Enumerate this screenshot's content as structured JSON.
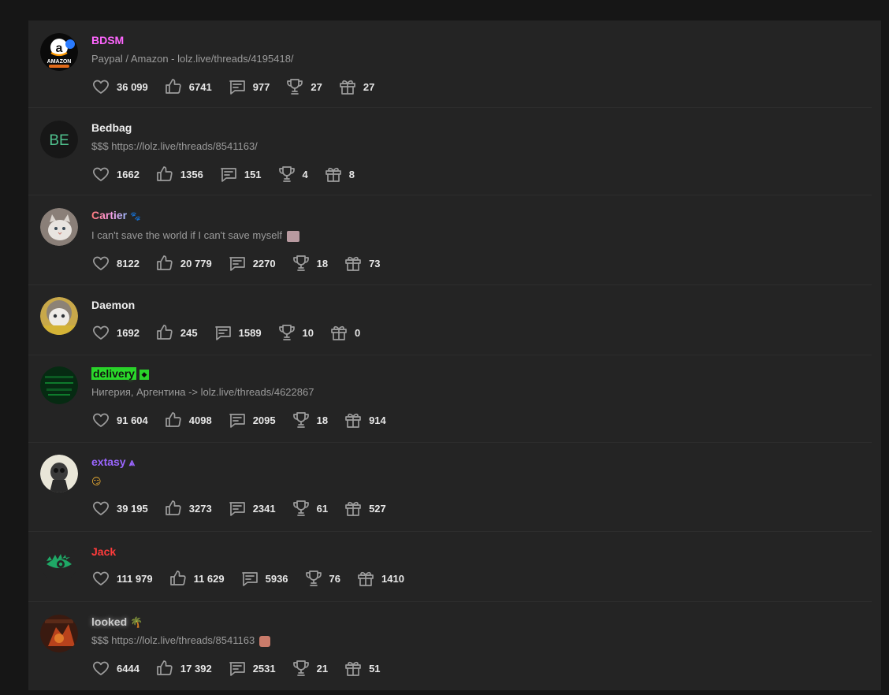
{
  "users": [
    {
      "name": "BDSM",
      "name_color": "#ff66ff",
      "status": "Paypal / Amazon - lolz.live/threads/4195418/",
      "avatar": "amazon-logo",
      "stats": {
        "likes": "36 099",
        "thumbs": "6741",
        "messages": "977",
        "trophies": "27",
        "gifts": "27"
      }
    },
    {
      "name": "Bedbag",
      "name_color": "#eeeeee",
      "status": "$$$ https://lolz.live/threads/8541163/",
      "avatar": "initials-BE",
      "avatar_text": "BE",
      "stats": {
        "likes": "1662",
        "thumbs": "1356",
        "messages": "151",
        "trophies": "4",
        "gifts": "8"
      }
    },
    {
      "name": "Cartier",
      "name_color": "#ff8ad8",
      "status": "I can't save the world if I can't save myself",
      "avatar": "cat-photo",
      "stats": {
        "likes": "8122",
        "thumbs": "20 779",
        "messages": "2270",
        "trophies": "18",
        "gifts": "73"
      }
    },
    {
      "name": "Daemon",
      "name_color": "#eeeeee",
      "status": "",
      "avatar": "kitten-photo",
      "stats": {
        "likes": "1692",
        "thumbs": "245",
        "messages": "1589",
        "trophies": "10",
        "gifts": "0"
      }
    },
    {
      "name": "delivery",
      "name_color": "#33ff33",
      "status": "Нигерия, Аргентина -> lolz.live/threads/4622867",
      "avatar": "green-matrix",
      "stats": {
        "likes": "91 604",
        "thumbs": "4098",
        "messages": "2095",
        "trophies": "18",
        "gifts": "914"
      }
    },
    {
      "name": "extasy",
      "name_color": "#9a66ff",
      "status": "",
      "avatar": "skull-art",
      "stats": {
        "likes": "39 195",
        "thumbs": "3273",
        "messages": "2341",
        "trophies": "61",
        "gifts": "527"
      }
    },
    {
      "name": "Jack",
      "name_color": "#ff3b3b",
      "status": "",
      "avatar": "eye-logo",
      "stats": {
        "likes": "111 979",
        "thumbs": "11 629",
        "messages": "5936",
        "trophies": "76",
        "gifts": "1410"
      }
    },
    {
      "name": "looked",
      "name_color": "#bdbdbd",
      "status": "$$$ https://lolz.live/threads/8541163",
      "avatar": "game-art",
      "stats": {
        "likes": "6444",
        "thumbs": "17 392",
        "messages": "2531",
        "trophies": "21",
        "gifts": "51"
      }
    }
  ],
  "icons": {
    "likes": "heart-icon",
    "thumbs": "thumbs-up-icon",
    "messages": "message-icon",
    "trophies": "trophy-icon",
    "gifts": "gift-icon"
  }
}
